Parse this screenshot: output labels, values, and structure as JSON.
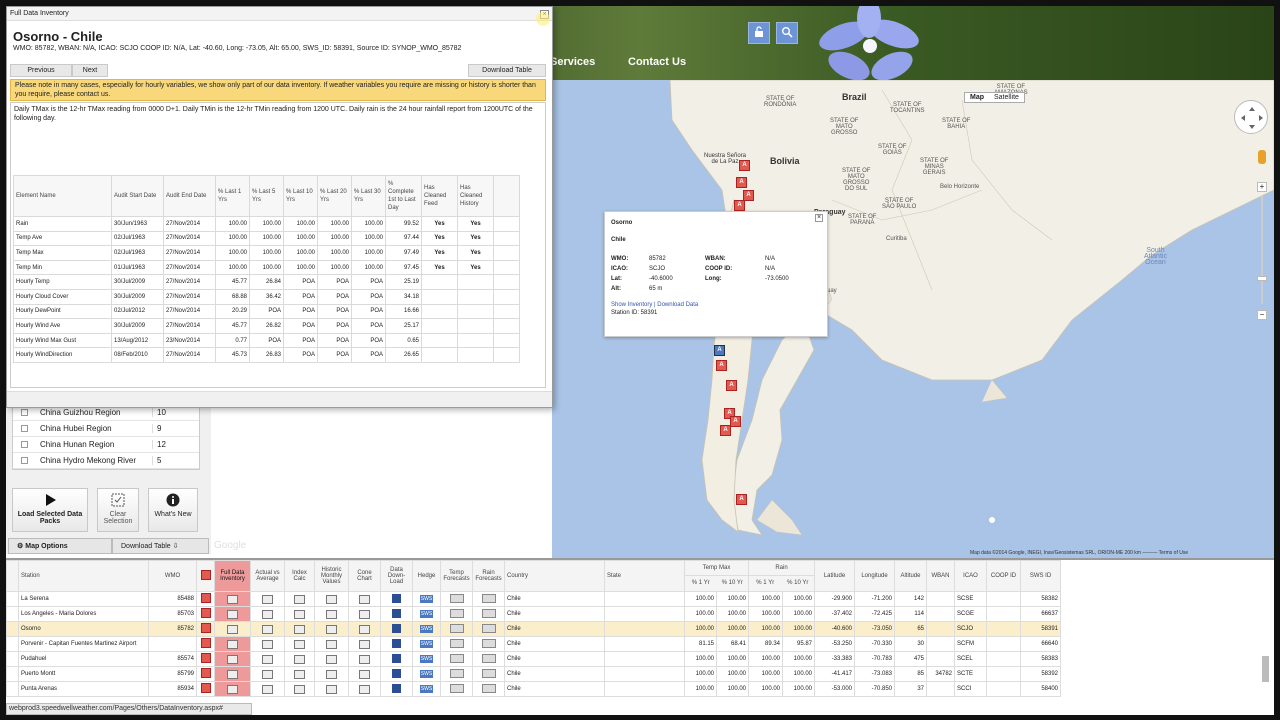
{
  "header": {
    "nav": [
      "Services",
      "Contact Us"
    ],
    "lock_icon": "unlock-icon",
    "search_icon": "search-icon",
    "accent": "#6c94d6"
  },
  "map": {
    "map_type": [
      "Map",
      "Satellite"
    ],
    "labels": {
      "brazil": "Brazil",
      "bolivia": "Bolivia",
      "paraguay": "Paraguay",
      "uruguay": "Uruguay",
      "south_atlantic": "South\nAtlantic\nOcean",
      "rondonia": "STATE OF\nRONDÔNIA",
      "tocantins": "STATE OF\nTOCANTINS",
      "bahia": "STATE OF\nBAHIA",
      "mato_grosso": "STATE OF\nMATO\nGROSSO",
      "goias": "STATE OF\nGOIÁS",
      "minas": "STATE OF\nMINAS\nGERAIS",
      "ms": "STATE OF\nMATO\nGROSSO\nDO SUL",
      "sp": "STATE OF\nSÃO PAULO",
      "parana": "STATE OF\nPARANÁ",
      "amazonas": "STATE OF\nAMAZONAS",
      "belo_horizonte": "Belo Horizonte",
      "curitiba": "Curitiba",
      "nuestra_senora": "Nuestra Señora\nde La Paz"
    },
    "attribution": "Map data ©2014 Google, INEGI, Inav/Geosistemas SRL, ORION-ME   200 km ———   Terms of Use",
    "info_window": {
      "station": "Osorno",
      "country": "Chile",
      "rows": [
        {
          "k1": "WMO:",
          "v1": "85782",
          "k2": "WBAN:",
          "v2": "N/A"
        },
        {
          "k1": "ICAO:",
          "v1": "SCJO",
          "k2": "COOP ID:",
          "v2": "N/A"
        },
        {
          "k1": "Lat:",
          "v1": "-40.6000",
          "k2": "Long:",
          "v2": "-73.0500"
        },
        {
          "k1": "Alt:",
          "v1": "65 m",
          "k2": "",
          "v2": ""
        }
      ],
      "links": "Show Inventory | Download Data",
      "station_id": "Station ID: 58391"
    }
  },
  "dialog": {
    "title": "Full Data Inventory",
    "station_name": "Osorno - Chile",
    "meta": "WMO: 85782, WBAN: N/A, ICAO: SCJO COOP ID: N/A, Lat: -40.60, Long: -73.05, Alt: 65.00, SWS_ID: 58391, Source ID: SYNOP_WMO_85782",
    "prev_label": "Previous",
    "next_label": "Next",
    "download_table_label": "Download Table",
    "warning": "Please note in many cases, especially for hourly variables, we show only part of our data inventory. If weather variables you require are missing or history is shorter than you require, please contact us.",
    "note": "Daily TMax is the 12-hr TMax reading from 0000 D+1. Daily TMin is the 12-hr TMin reading from 1200 UTC. Daily rain is the 24 hour rainfall report from 1200UTC of the following day.",
    "columns": [
      "Element Name",
      "Audit Start Date",
      "Audit End Date",
      "% Last 1 Yrs",
      "% Last 5 Yrs",
      "% Last 10 Yrs",
      "% Last 20 Yrs",
      "% Last 30 Yrs",
      "% Complete 1st to Last Day",
      "Has Cleaned Feed",
      "Has Cleaned History"
    ],
    "rows": [
      [
        "Rain",
        "30/Jun/1963",
        "27/Nov/2014",
        "100.00",
        "100.00",
        "100.00",
        "100.00",
        "100.00",
        "99.52",
        "Yes",
        "Yes"
      ],
      [
        "Temp Ave",
        "02/Jul/1963",
        "27/Nov/2014",
        "100.00",
        "100.00",
        "100.00",
        "100.00",
        "100.00",
        "97.44",
        "Yes",
        "Yes"
      ],
      [
        "Temp Max",
        "02/Jul/1963",
        "27/Nov/2014",
        "100.00",
        "100.00",
        "100.00",
        "100.00",
        "100.00",
        "97.49",
        "Yes",
        "Yes"
      ],
      [
        "Temp Min",
        "01/Jul/1963",
        "27/Nov/2014",
        "100.00",
        "100.00",
        "100.00",
        "100.00",
        "100.00",
        "97.45",
        "Yes",
        "Yes"
      ],
      [
        "Hourly Temp",
        "30/Jul/2009",
        "27/Nov/2014",
        "45.77",
        "26.84",
        "POA",
        "POA",
        "POA",
        "25.19",
        "",
        ""
      ],
      [
        "Hourly Cloud Cover",
        "30/Jul/2009",
        "27/Nov/2014",
        "68.88",
        "36.42",
        "POA",
        "POA",
        "POA",
        "34.18",
        "",
        ""
      ],
      [
        "Hourly DewPoint",
        "02/Jul/2012",
        "27/Nov/2014",
        "20.29",
        "POA",
        "POA",
        "POA",
        "POA",
        "16.66",
        "",
        ""
      ],
      [
        "Hourly Wind Ave",
        "30/Jul/2009",
        "27/Nov/2014",
        "45.77",
        "26.82",
        "POA",
        "POA",
        "POA",
        "25.17",
        "",
        ""
      ],
      [
        "Hourly Wind Max Gust",
        "13/Aug/2012",
        "23/Nov/2014",
        "0.77",
        "POA",
        "POA",
        "POA",
        "POA",
        "0.65",
        "",
        ""
      ],
      [
        "Hourly WindDirection",
        "08/Feb/2010",
        "27/Nov/2014",
        "45.73",
        "26.83",
        "POA",
        "POA",
        "POA",
        "26.65",
        "",
        ""
      ]
    ]
  },
  "sidebar": {
    "regions": [
      {
        "name": "China Guizhou Region",
        "count": "10"
      },
      {
        "name": "China Hubei Region",
        "count": "9"
      },
      {
        "name": "China Hunan Region",
        "count": "12"
      },
      {
        "name": "China Hydro Mekong River",
        "count": "5"
      }
    ],
    "load_btn": "Load Selected Data Packs",
    "clear_btn": "Clear Selection",
    "whats_new_btn": "What's New",
    "map_options_tab": "Map Options",
    "download_table_tab": "Download Table",
    "google_text": "Google"
  },
  "grid": {
    "group_headers": {
      "temp_max": "Temp Max",
      "rain": "Rain"
    },
    "columns": [
      "Station",
      "WMO",
      "",
      "Full Data Inventory",
      "Actual vs Average",
      "Index Calc",
      "Historic Monthly Values",
      "Cone Chart",
      "Data Down-Load",
      "Hedge",
      "Temp Forecasts",
      "Rain Forecasts",
      "Country",
      "State",
      "% 1 Yr",
      "% 10 Yr",
      "% 1 Yr",
      "% 10 Yr",
      "Latitude",
      "Longitude",
      "Altitude",
      "WBAN",
      "ICAO",
      "COOP ID",
      "SWS ID"
    ],
    "rows": [
      {
        "station": "La Serena",
        "wmo": "85488",
        "country": "Chile",
        "state": "",
        "t1": "100.00",
        "t10": "100.00",
        "r1": "100.00",
        "r10": "100.00",
        "lat": "-29.900",
        "lon": "-71.200",
        "alt": "142",
        "wban": "",
        "icao": "SCSE",
        "coop": "",
        "sws": "58382"
      },
      {
        "station": "Los Angeles - Maria Dolores",
        "wmo": "85703",
        "country": "Chile",
        "state": "",
        "t1": "100.00",
        "t10": "100.00",
        "r1": "100.00",
        "r10": "100.00",
        "lat": "-37.402",
        "lon": "-72.425",
        "alt": "114",
        "wban": "",
        "icao": "SCGE",
        "coop": "",
        "sws": "66637"
      },
      {
        "station": "Osorno",
        "wmo": "85782",
        "country": "Chile",
        "state": "",
        "t1": "100.00",
        "t10": "100.00",
        "r1": "100.00",
        "r10": "100.00",
        "lat": "-40.600",
        "lon": "-73.050",
        "alt": "65",
        "wban": "",
        "icao": "SCJO",
        "coop": "",
        "sws": "58391"
      },
      {
        "station": "Porvenir - Capitan Fuentes Martinez Airport",
        "wmo": "",
        "country": "Chile",
        "state": "",
        "t1": "81.15",
        "t10": "68.41",
        "r1": "89.34",
        "r10": "95.87",
        "lat": "-53.250",
        "lon": "-70.330",
        "alt": "30",
        "wban": "",
        "icao": "SCFM",
        "coop": "",
        "sws": "66640"
      },
      {
        "station": "Pudahuel",
        "wmo": "85574",
        "country": "Chile",
        "state": "",
        "t1": "100.00",
        "t10": "100.00",
        "r1": "100.00",
        "r10": "100.00",
        "lat": "-33.383",
        "lon": "-70.783",
        "alt": "475",
        "wban": "",
        "icao": "SCEL",
        "coop": "",
        "sws": "58383"
      },
      {
        "station": "Puerto Montt",
        "wmo": "85799",
        "country": "Chile",
        "state": "",
        "t1": "100.00",
        "t10": "100.00",
        "r1": "100.00",
        "r10": "100.00",
        "lat": "-41.417",
        "lon": "-73.083",
        "alt": "85",
        "wban": "34782",
        "icao": "SCTE",
        "coop": "",
        "sws": "58392"
      },
      {
        "station": "Punta Arenas",
        "wmo": "85934",
        "country": "Chile",
        "state": "",
        "t1": "100.00",
        "t10": "100.00",
        "r1": "100.00",
        "r10": "100.00",
        "lat": "-53.000",
        "lon": "-70.850",
        "alt": "37",
        "wban": "",
        "icao": "SCCI",
        "coop": "",
        "sws": "58400"
      }
    ]
  },
  "status_url": "webprod3.speedwellweather.com/Pages/Others/DataInventory.aspx#"
}
